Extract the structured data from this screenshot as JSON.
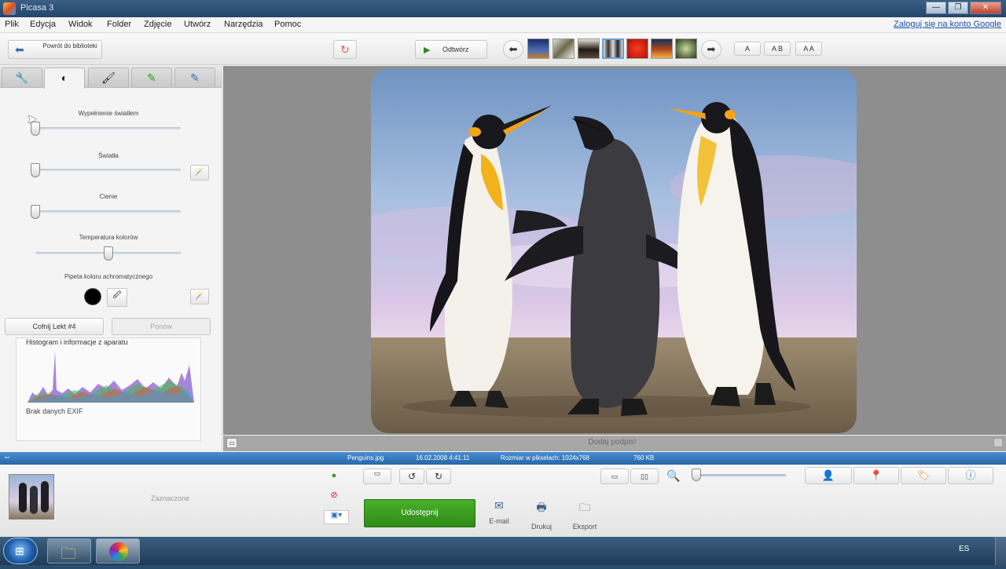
{
  "window": {
    "title": "Picasa 3",
    "minimize": "—",
    "maximize": "❐",
    "close": "✕"
  },
  "menu": {
    "items": [
      "Plik",
      "Edycja",
      "Widok",
      "Folder",
      "Zdjęcie",
      "Utwórz",
      "Narzędzia",
      "Pomoc"
    ],
    "signin": "Zaloguj się na konto Google"
  },
  "toolbar": {
    "back_label": "Powrót do biblioteki",
    "play_label": "Odtwórz",
    "view_buttons": [
      "A",
      "A B",
      "A A"
    ]
  },
  "tuning": {
    "tabs": [
      "wrench-icon",
      "contrast-icon",
      "brush-icon",
      "effects-icon",
      "effects2-icon"
    ],
    "sliders": [
      {
        "label": "Wypełnienie światłem",
        "value": 0.0
      },
      {
        "label": "Światła",
        "value": 0.0
      },
      {
        "label": "Cienie",
        "value": 0.0
      },
      {
        "label": "Temperatura kolorów",
        "value": 0.5
      }
    ],
    "neutral_label": "Pipeta koloru achromatycznego",
    "undo_button": "Cofnij Lekt #4",
    "redo_button": "Ponów",
    "histogram_title": "Histogram i informacje z aparatu",
    "exif_text": "Brak danych EXIF"
  },
  "viewer": {
    "caption_placeholder": "Dodaj podpis!"
  },
  "status": {
    "filename": "Penguins.jpg",
    "date": "16.02.2008 4:41:11",
    "size_label": "Rozmiar w pikselach: 1024x768",
    "filesize": "760 KB"
  },
  "bottom": {
    "selection_label": "Zaznaczone",
    "upload_button": "Udostępnij",
    "actions": [
      {
        "icon": "email-icon",
        "label": "E-mail"
      },
      {
        "icon": "print-icon",
        "label": "Drukuj"
      },
      {
        "icon": "export-icon",
        "label": "Eksport"
      }
    ]
  },
  "taskbar": {
    "tray_text": "ES"
  },
  "colors": {
    "accent_green": "#3a9a1c",
    "status_blue": "#2f74b8",
    "link_blue": "#1a4fb5"
  }
}
